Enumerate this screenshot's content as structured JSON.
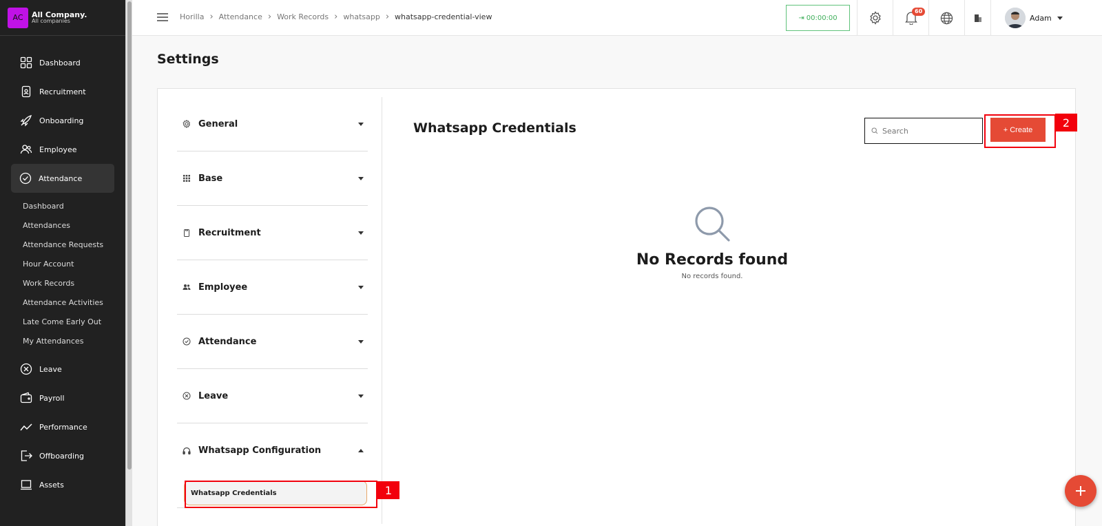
{
  "company": {
    "logo_text": "AC",
    "name": "All Company.",
    "subtitle": "All companies"
  },
  "sidebar": {
    "items": [
      {
        "label": "Dashboard",
        "icon": "dashboard-icon"
      },
      {
        "label": "Recruitment",
        "icon": "recruitment-icon"
      },
      {
        "label": "Onboarding",
        "icon": "rocket-icon"
      },
      {
        "label": "Employee",
        "icon": "people-icon"
      },
      {
        "label": "Attendance",
        "icon": "check-circle-icon",
        "active": true
      },
      {
        "label": "Leave",
        "icon": "x-circle-icon"
      },
      {
        "label": "Payroll",
        "icon": "wallet-icon"
      },
      {
        "label": "Performance",
        "icon": "trend-icon"
      },
      {
        "label": "Offboarding",
        "icon": "exit-icon"
      },
      {
        "label": "Assets",
        "icon": "laptop-icon"
      }
    ],
    "attendance_sub": [
      "Dashboard",
      "Attendances",
      "Attendance Requests",
      "Hour Account",
      "Work Records",
      "Attendance Activities",
      "Late Come Early Out",
      "My Attendances"
    ]
  },
  "breadcrumb": [
    "Horilla",
    "Attendance",
    "Work Records",
    "whatsapp",
    "whatsapp-credential-view"
  ],
  "topbar": {
    "timer": "00:00:00",
    "notifications": "60",
    "user_name": "Adam"
  },
  "page": {
    "title": "Settings"
  },
  "settings_menu": [
    {
      "label": "General",
      "icon": "gear-icon"
    },
    {
      "label": "Base",
      "icon": "grid-icon"
    },
    {
      "label": "Recruitment",
      "icon": "clipboard-icon"
    },
    {
      "label": "Employee",
      "icon": "people-icon"
    },
    {
      "label": "Attendance",
      "icon": "check-circle-icon"
    },
    {
      "label": "Leave",
      "icon": "x-circle-icon"
    },
    {
      "label": "Whatsapp Configuration",
      "icon": "headset-icon",
      "open": true
    }
  ],
  "settings_submenu": {
    "label": "Whatsapp Credentials"
  },
  "main": {
    "title": "Whatsapp Credentials",
    "search_placeholder": "Search",
    "create_label": "+ Create",
    "empty_title": "No Records found",
    "empty_text": "No records found."
  },
  "annotations": {
    "label_1": "1",
    "label_2": "2"
  },
  "colors": {
    "accent": "#e54a35",
    "sidebar": "#212121",
    "timer": "#3faf5b",
    "annotation": "#f2000c"
  }
}
